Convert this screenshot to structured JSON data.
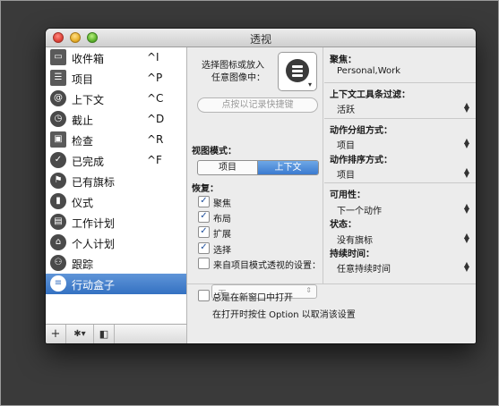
{
  "window": {
    "title": "透视"
  },
  "sidebar": {
    "items": [
      {
        "label": "收件箱",
        "shortcut": "^I"
      },
      {
        "label": "项目",
        "shortcut": "^P"
      },
      {
        "label": "上下文",
        "shortcut": "^C"
      },
      {
        "label": "截止",
        "shortcut": "^D"
      },
      {
        "label": "检查",
        "shortcut": "^R"
      },
      {
        "label": "已完成",
        "shortcut": "^F"
      },
      {
        "label": "已有旗标",
        "shortcut": ""
      },
      {
        "label": "仪式",
        "shortcut": ""
      },
      {
        "label": "工作计划",
        "shortcut": ""
      },
      {
        "label": "个人计划",
        "shortcut": ""
      },
      {
        "label": "跟踪",
        "shortcut": ""
      },
      {
        "label": "行动盒子",
        "shortcut": ""
      }
    ],
    "selected_index": 11,
    "bottom_bar": {
      "add": "+",
      "gear": "✱▾",
      "toggle": "◧"
    }
  },
  "middle": {
    "icon_hint_1": "选择图标或放入",
    "icon_hint_2": "任意图像中：",
    "shortcut_button": "点按以记录快捷键",
    "view_mode_label": "视图模式：",
    "view_modes": [
      "项目",
      "上下文"
    ],
    "view_mode_selected": 1,
    "restore_label": "恢复：",
    "restore_options": [
      {
        "label": "聚焦",
        "checked": true
      },
      {
        "label": "布局",
        "checked": true
      },
      {
        "label": "扩展",
        "checked": true
      },
      {
        "label": "选择",
        "checked": true
      },
      {
        "label": "来自项目模式透视的设置：",
        "checked": false
      }
    ],
    "project_setting_value": "无",
    "open_new_window": {
      "label": "总是在新窗口中打开",
      "checked": false
    },
    "open_hint": "在打开时按住 Option 以取消该设置"
  },
  "right": {
    "focus_label": "聚焦：",
    "focus_value": "Personal,Work",
    "toolbar_filter_label": "上下文工具条过滤：",
    "toolbar_filter_value": "活跃",
    "grouping_label": "动作分组方式：",
    "grouping_value": "项目",
    "sorting_label": "动作排序方式：",
    "sorting_value": "项目",
    "availability_label": "可用性：",
    "availability_value": "下一个动作",
    "status_label": "状态：",
    "status_value": "没有旗标",
    "duration_label": "持续时间：",
    "duration_value": "任意持续时间"
  }
}
